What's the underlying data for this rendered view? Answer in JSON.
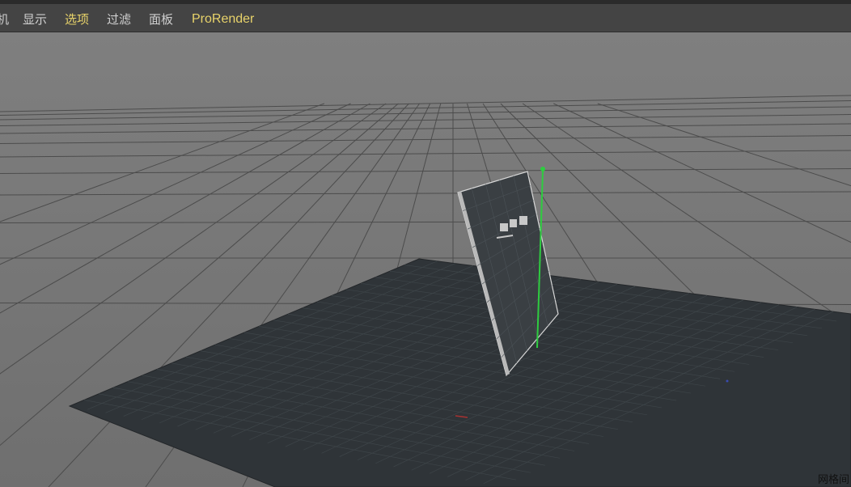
{
  "menubar": {
    "items": [
      {
        "label": "机",
        "state": "normal"
      },
      {
        "label": "显示",
        "state": "normal"
      },
      {
        "label": "选项",
        "state": "active"
      },
      {
        "label": "过滤",
        "state": "normal"
      },
      {
        "label": "面板",
        "state": "normal"
      },
      {
        "label": "ProRender",
        "state": "plugin"
      }
    ]
  },
  "viewport": {
    "background_color": "#7d7d7d",
    "grid_line_color": "#4a4a4a",
    "plane_color": "#2f3438",
    "object_color": "#3a3f43",
    "manipulator_color": "#2ecc40",
    "hud_label": "网格间"
  }
}
